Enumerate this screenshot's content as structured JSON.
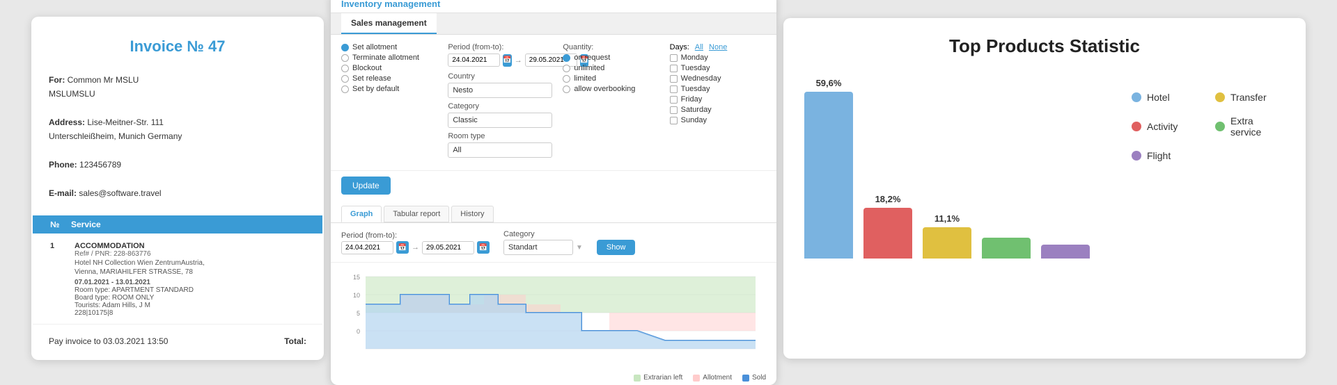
{
  "invoice": {
    "title": "Invoice № 47",
    "for_label": "For:",
    "for_value": "Common Mr MSLU",
    "company": "MSLUMSLU",
    "address_label": "Address:",
    "address_value": "Lise-Meitner-Str. 111",
    "address_city": "Unterschleißheim, Munich Germany",
    "phone_label": "Phone:",
    "phone_value": "123456789",
    "email_label": "E-mail:",
    "email_value": "sales@software.travel",
    "table_col_no": "№",
    "table_col_service": "Service",
    "row_num": "1",
    "service_title": "ACCOMMODATION",
    "service_ref": "Ref# / PNR: 228-863776",
    "service_hotel": "Hotel NH Collection Wien ZentrumAustria,",
    "service_hotel2": "Vienna, MARIAHILFER STRASSE, 78",
    "service_dates": "07.01.2021 - 13.01.2021",
    "service_room": "Room type: APARTMENT STANDARD",
    "service_board": "Board type: ROOM ONLY",
    "service_tourists": "Tourists: Adam Hills, J M",
    "service_tourists2": "228|10175|8",
    "pay_text": "Pay invoice to 03.03.2021 13:50",
    "total_label": "Total:"
  },
  "inventory": {
    "title": "Inventory management",
    "tab": "Sales management",
    "set_allotment": "Set allotment",
    "terminate_allotment": "Terminate allotment",
    "blockout": "Blockout",
    "set_release": "Set release",
    "set_by_default": "Set by default",
    "period_label": "Period (from-to):",
    "date_from": "24.04.2021",
    "date_to": "29.05.2021",
    "country_label": "Country",
    "country_value": "Nesto",
    "category_label": "Category",
    "category_value": "Classic",
    "room_type_label": "Room type",
    "room_type_value": "All",
    "quantity_label": "Quantity:",
    "qty_on_request": "on request",
    "qty_unlimited": "unlimited",
    "qty_limited": "limited",
    "qty_allow": "allow overbooking",
    "days_label": "Days:",
    "all_link": "All",
    "none_link": "None",
    "monday": "Monday",
    "tuesday": "Tuesday",
    "wednesday": "Wednesday",
    "tuesday2": "Tuesday",
    "friday": "Friday",
    "saturday": "Saturday",
    "sunday": "Sunday",
    "update_btn": "Update",
    "graph_tab": "Graph",
    "tabular_tab": "Tabular report",
    "history_tab": "History",
    "period_label2": "Period (from-to):",
    "date_from2": "24.04.2021",
    "date_to2": "29.05.2021",
    "category_label2": "Category",
    "category_value2": "Standart",
    "show_btn": "Show",
    "y_label_15": "15",
    "y_label_10": "10",
    "y_label_5": "5",
    "y_label_0": "0",
    "legend_extraran": "Extrarian left",
    "legend_allotment": "Allotment",
    "legend_sold": "Sold"
  },
  "stats": {
    "title": "Top Products Statistic",
    "bar1_pct": "59,6%",
    "bar1_color": "#7ab3e0",
    "bar2_pct": "18,2%",
    "bar2_color": "#e06060",
    "bar3_pct": "11,1%",
    "bar3_color": "#e0c040",
    "bar4_pct": "",
    "bar4_color": "#70c070",
    "bar5_pct": "",
    "bar5_color": "#9b80c0",
    "legend_hotel": "Hotel",
    "legend_hotel_color": "#7ab3e0",
    "legend_activity": "Activity",
    "legend_activity_color": "#e06060",
    "legend_flight": "Flight",
    "legend_flight_color": "#9b80c0",
    "legend_transfer": "Transfer",
    "legend_transfer_color": "#e0c040",
    "legend_extra": "Extra service",
    "legend_extra_color": "#70c070"
  }
}
